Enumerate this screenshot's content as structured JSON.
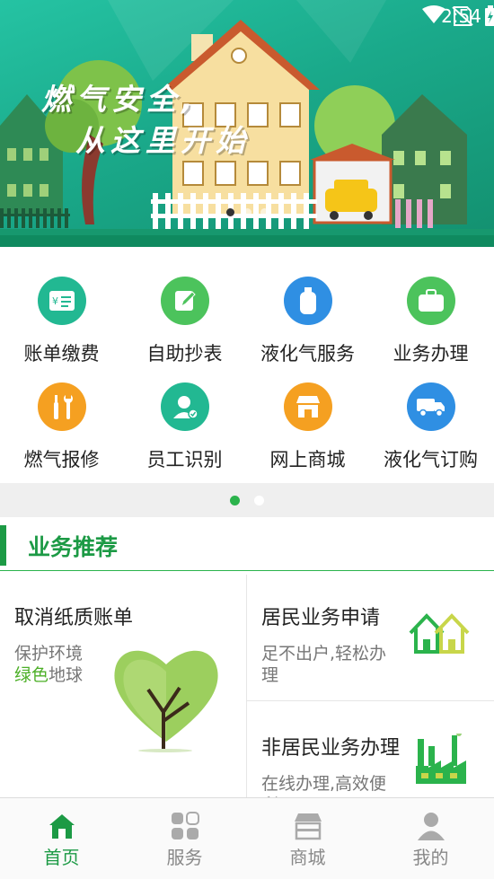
{
  "status": {
    "time": "2:54"
  },
  "banner": {
    "slogan_line1": "燃气安全,",
    "slogan_line2": "从这里开始",
    "active_slide": 1
  },
  "services": [
    {
      "label": "账单缴费",
      "icon": "bill-icon",
      "color": "#22b892"
    },
    {
      "label": "自助抄表",
      "icon": "edit-icon",
      "color": "#4cc35c"
    },
    {
      "label": "液化气服务",
      "icon": "gas-cylinder-icon",
      "color": "#2f8fe3"
    },
    {
      "label": "业务办理",
      "icon": "briefcase-icon",
      "color": "#4cc35c"
    },
    {
      "label": "燃气报修",
      "icon": "repair-tools-icon",
      "color": "#f5a021"
    },
    {
      "label": "员工识别",
      "icon": "staff-id-icon",
      "color": "#22b892"
    },
    {
      "label": "网上商城",
      "icon": "shop-icon",
      "color": "#f5a021"
    },
    {
      "label": "液化气订购",
      "icon": "delivery-truck-icon",
      "color": "#2f8fe3"
    }
  ],
  "grid_pager": {
    "pages": 2,
    "active": 1
  },
  "section": {
    "title": "业务推荐"
  },
  "cards": {
    "left": {
      "title": "取消纸质账单",
      "desc_line1": "保护环境",
      "desc_green": "绿色",
      "desc_rest": "地球"
    },
    "right_top": {
      "title": "居民业务申请",
      "desc": "足不出户,轻松办理"
    },
    "right_bottom": {
      "title": "非居民业务办理",
      "desc": "在线办理,高效便利"
    }
  },
  "tabs": [
    {
      "label": "首页",
      "icon": "home-icon",
      "active": true
    },
    {
      "label": "服务",
      "icon": "grid-icon",
      "active": false
    },
    {
      "label": "商城",
      "icon": "store-icon",
      "active": false
    },
    {
      "label": "我的",
      "icon": "profile-icon",
      "active": false
    }
  ],
  "colors": {
    "primary": "#1c9a45",
    "accent": "#2bb34c",
    "banner": "#1aa98a"
  }
}
